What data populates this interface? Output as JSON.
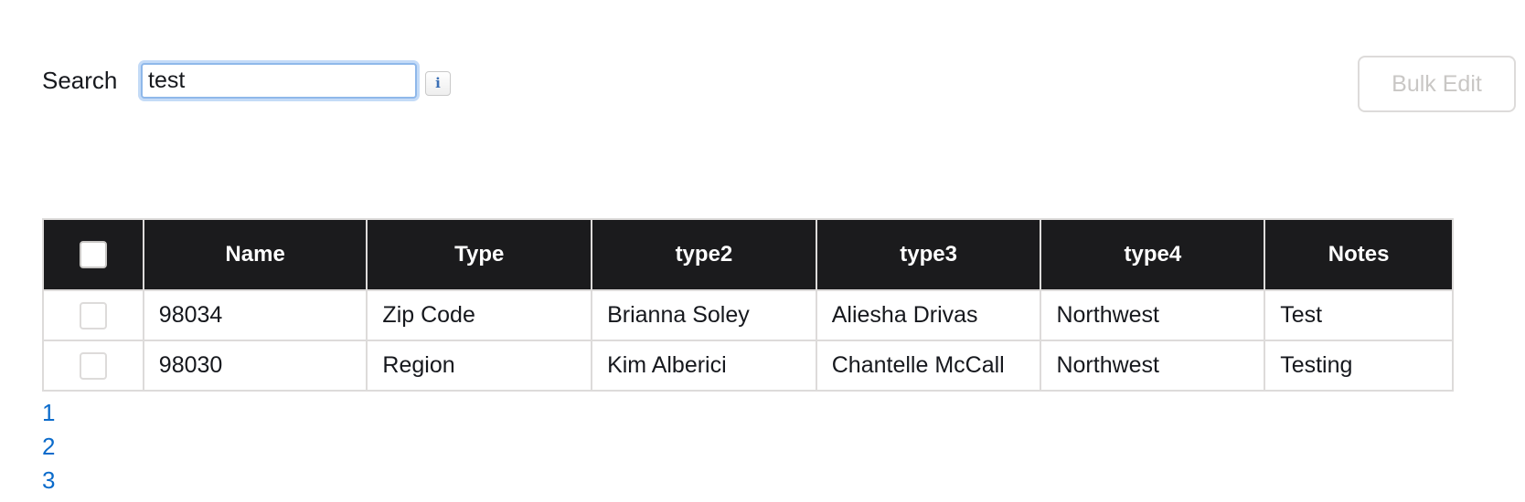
{
  "search": {
    "label": "Search",
    "value": "test",
    "info_icon": "info-icon"
  },
  "toolbar": {
    "bulk_edit_label": "Bulk Edit"
  },
  "table": {
    "columns": [
      "Name",
      "Type",
      "type2",
      "type3",
      "type4",
      "Notes"
    ],
    "rows": [
      [
        "98034",
        "Zip Code",
        "Brianna Soley",
        "Aliesha Drivas",
        "Northwest",
        "Test"
      ],
      [
        "98030",
        "Region",
        "Kim Alberici",
        "Chantelle McCall",
        "Northwest",
        "Testing"
      ]
    ]
  },
  "pagination": {
    "pages": [
      "1",
      "2",
      "3"
    ]
  },
  "colors": {
    "header_bg": "#1b1b1d",
    "link": "#0b6bcb",
    "focus_ring": "#8fb8ea",
    "disabled_text": "#c9c7c5"
  }
}
